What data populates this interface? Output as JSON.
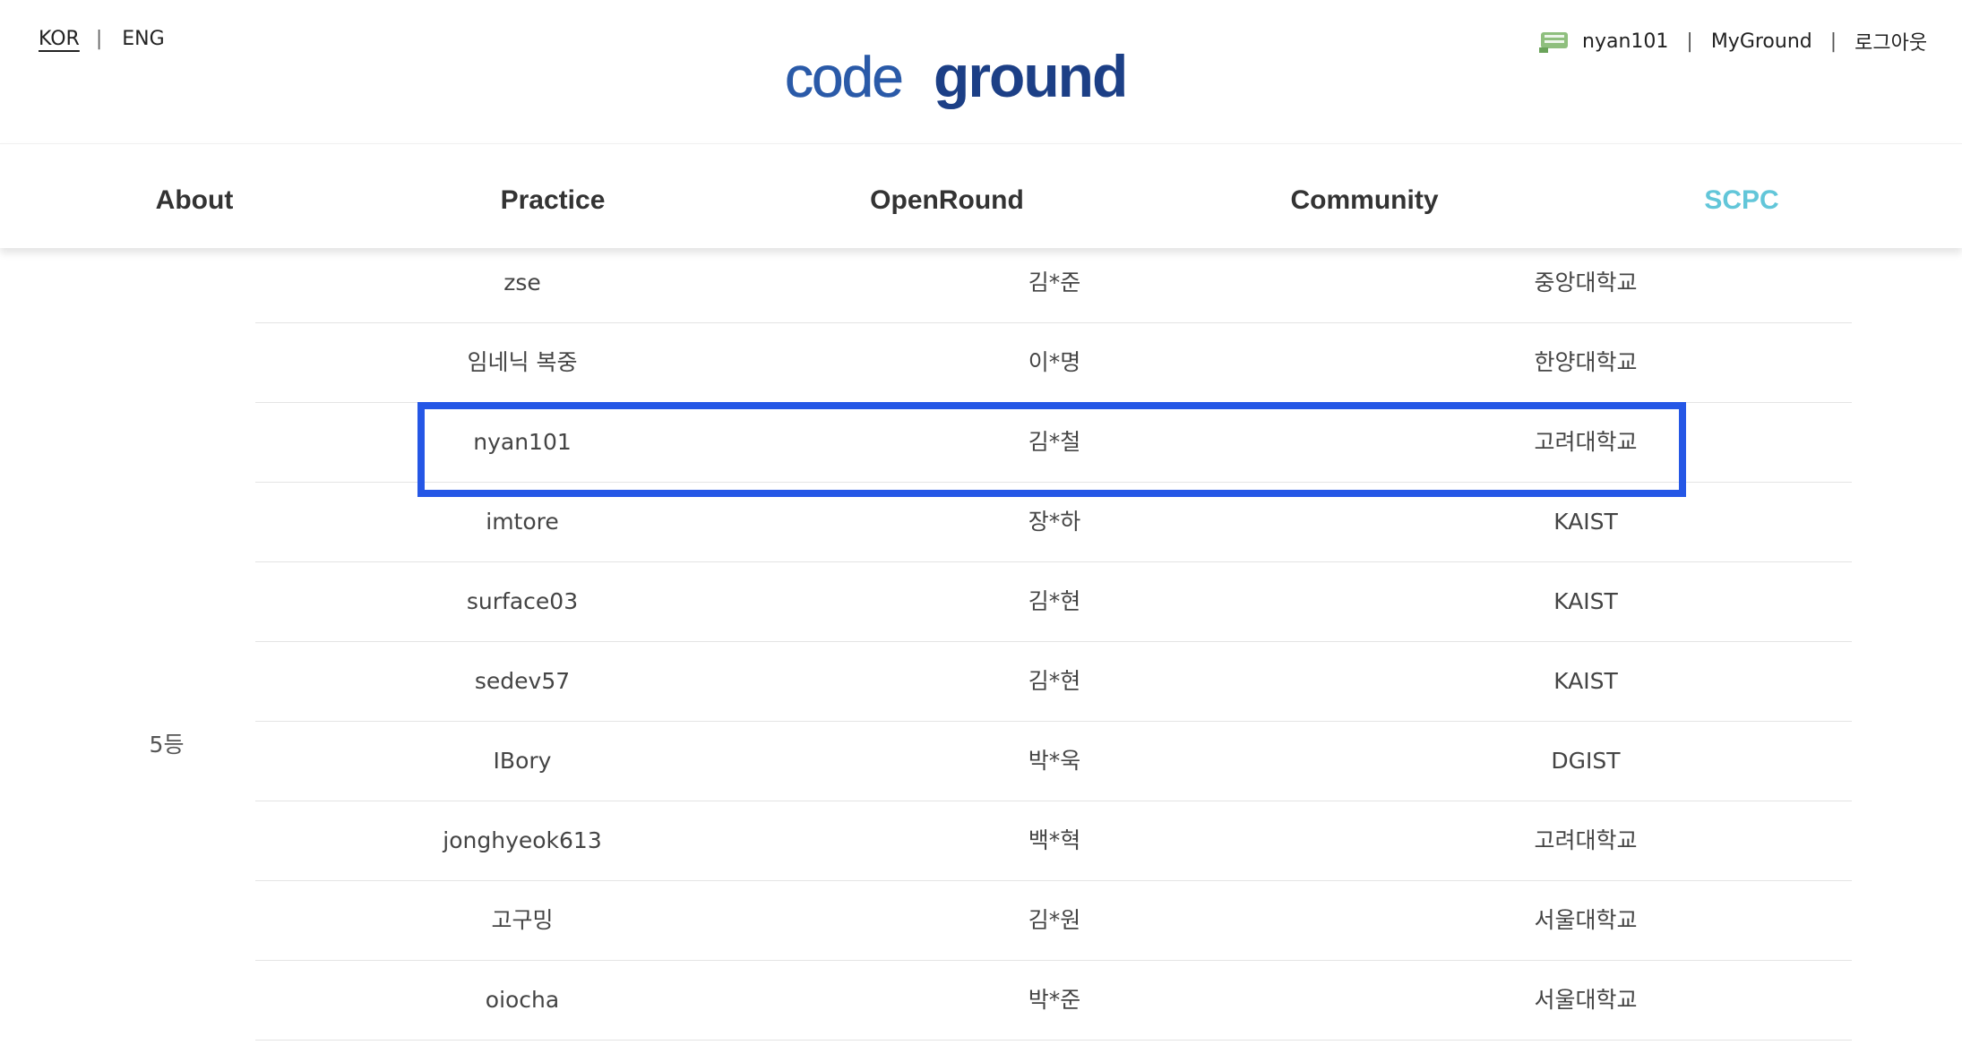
{
  "lang": {
    "kor": "KOR",
    "sep": "|",
    "eng": "ENG"
  },
  "logo": {
    "part1": "code",
    "part2": "ground",
    "color1": "#2a5aa8",
    "color2": "#1c3f86"
  },
  "user": {
    "badge_icon": "user-level-badge-icon",
    "username": "nyan101",
    "myground": "MyGround",
    "logout": "로그아웃",
    "sep": "|"
  },
  "nav": {
    "items": [
      {
        "label": "About"
      },
      {
        "label": "Practice"
      },
      {
        "label": "OpenRound"
      },
      {
        "label": "Community"
      },
      {
        "label": "SCPC",
        "active": true
      }
    ],
    "active_color": "#62c6d9"
  },
  "ranking": {
    "rank_label": "5등",
    "highlight_color": "#2557e6",
    "rows": [
      {
        "handle": "zse",
        "name": "김*준",
        "school": "중앙대학교"
      },
      {
        "handle": "임네닉 복중",
        "name": "이*명",
        "school": "한양대학교"
      },
      {
        "handle": "nyan101",
        "name": "김*철",
        "school": "고려대학교",
        "highlighted": true
      },
      {
        "handle": "imtore",
        "name": "장*하",
        "school": "KAIST"
      },
      {
        "handle": "surface03",
        "name": "김*현",
        "school": "KAIST"
      },
      {
        "handle": "sedev57",
        "name": "김*현",
        "school": "KAIST"
      },
      {
        "handle": "IBory",
        "name": "박*욱",
        "school": "DGIST"
      },
      {
        "handle": "jonghyeok613",
        "name": "백*혁",
        "school": "고려대학교"
      },
      {
        "handle": "고구밍",
        "name": "김*원",
        "school": "서울대학교"
      },
      {
        "handle": "oiocha",
        "name": "박*준",
        "school": "서울대학교"
      }
    ]
  }
}
